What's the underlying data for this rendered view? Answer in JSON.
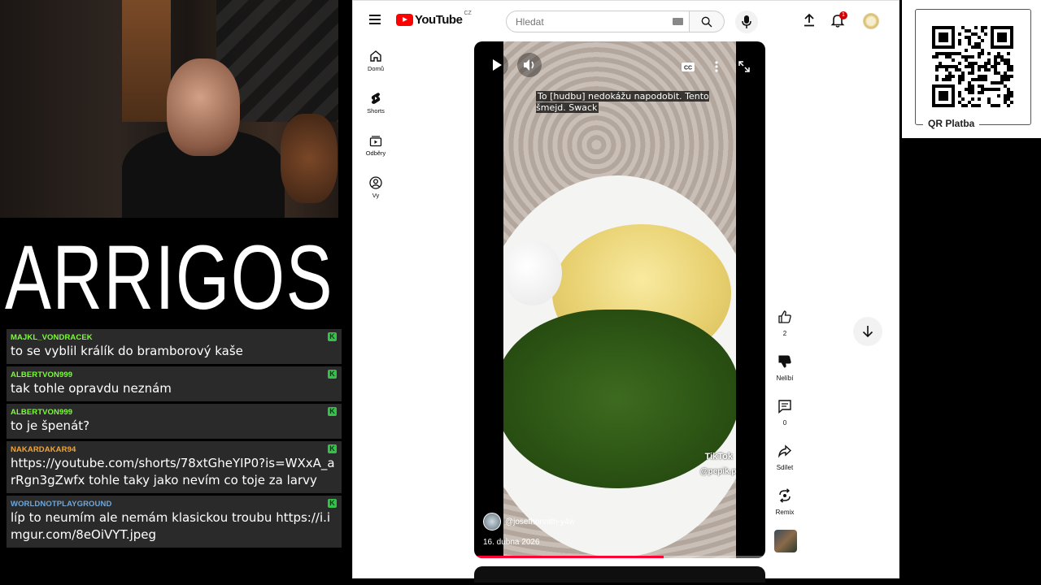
{
  "stream": {
    "logo_text": "ARRIGOS",
    "chat": [
      {
        "user": "MAJKL_VONDRACEK",
        "user_color": "#7cfc3a",
        "text": "to se vyblil králík do bramborový kaše"
      },
      {
        "user": "ALBERTVON999",
        "user_color": "#7cfc3a",
        "text": "tak tohle opravdu neznám"
      },
      {
        "user": "ALBERTVON999",
        "user_color": "#7cfc3a",
        "text": "to je špenát?"
      },
      {
        "user": "NAKARDAKAR94",
        "user_color": "#f0a63a",
        "text": "https://youtube.com/shorts/78xtGheYIP0?is=WXxA_arRgn3gZwfx tohle taky jako nevím co toje za larvy"
      },
      {
        "user": "WORLDNOTPLAYGROUND",
        "user_color": "#6fa8dc",
        "text": "líp to neumím ale nemám klasickou troubu https://i.imgur.com/8eOiVYT.jpeg"
      }
    ],
    "kick_badge": "K"
  },
  "youtube": {
    "logo_word": "YouTube",
    "logo_country": "CZ",
    "search_placeholder": "Hledat",
    "notification_count": "1",
    "nav": [
      {
        "label": "Domů",
        "icon": "home-icon"
      },
      {
        "label": "Shorts",
        "icon": "shorts-icon"
      },
      {
        "label": "Odběry",
        "icon": "subscriptions-icon"
      },
      {
        "label": "Vy",
        "icon": "you-icon"
      }
    ],
    "short": {
      "caption": "To [hudbu] nedokážu napodobit. Tento šmejd. Swack",
      "channel": "@josefhorvath-y4w",
      "date": "16. dubna 2026",
      "watermark_app": "TikTok",
      "watermark_user": "@pepik.pepano",
      "progress": 0.65
    },
    "actions": {
      "like_count": "2",
      "dislike_label": "Nelíbí",
      "comment_count": "0",
      "share_label": "Sdílet",
      "remix_label": "Remix"
    }
  },
  "qr": {
    "label": "QR Platba"
  },
  "colors": {
    "yt_red": "#ff0000",
    "progress_red": "#ff0033",
    "chat_bg": "#2a2a2a",
    "kick_green": "#35c24a"
  }
}
